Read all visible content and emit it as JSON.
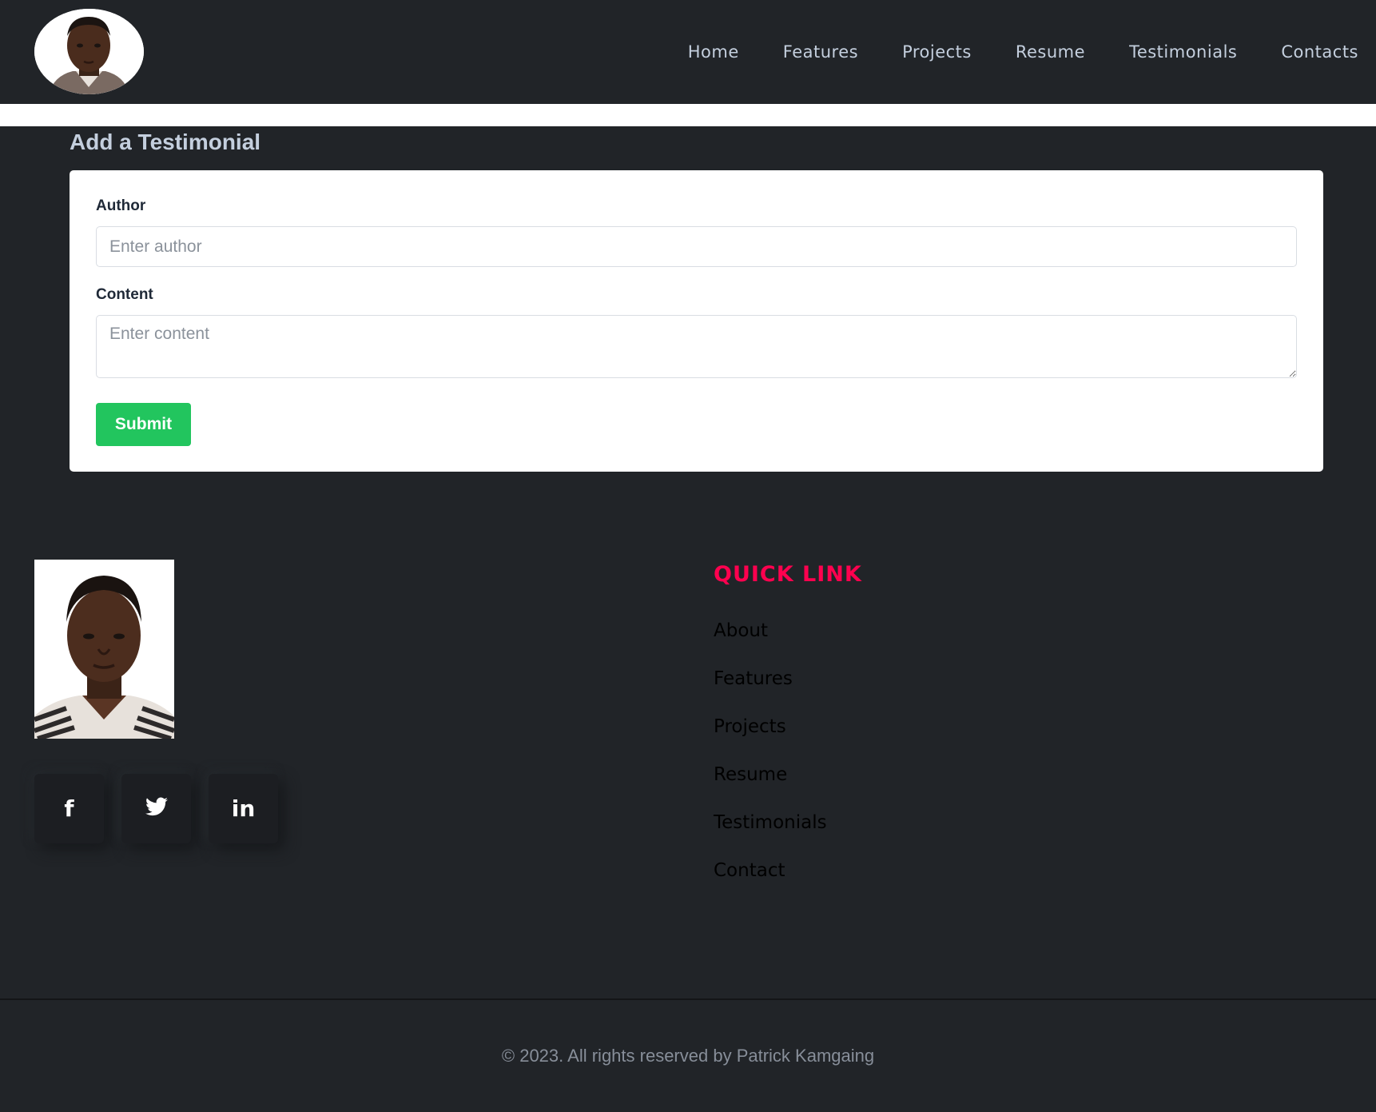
{
  "header": {
    "nav": [
      "Home",
      "Features",
      "Projects",
      "Resume",
      "Testimonials",
      "Contacts"
    ]
  },
  "form": {
    "title": "Add a Testimonial",
    "author_label": "Author",
    "author_placeholder": "Enter author",
    "author_value": "",
    "content_label": "Content",
    "content_placeholder": "Enter content",
    "content_value": "",
    "submit_label": "Submit",
    "submit_color": "#22c55e"
  },
  "footer": {
    "social": [
      {
        "icon": "facebook-icon",
        "glyph": "f"
      },
      {
        "icon": "twitter-icon",
        "glyph": "🐦"
      },
      {
        "icon": "linkedin-icon",
        "glyph": "in"
      }
    ],
    "quick_link_title": "QUICK LINK",
    "quick_links": [
      "About",
      "Features",
      "Projects",
      "Resume",
      "Testimonials",
      "Contact"
    ],
    "copyright": "© 2023. All rights reserved by Patrick Kamgaing"
  },
  "colors": {
    "background": "#212428",
    "accent": "#ff014f",
    "nav_text": "#c4cfde"
  }
}
